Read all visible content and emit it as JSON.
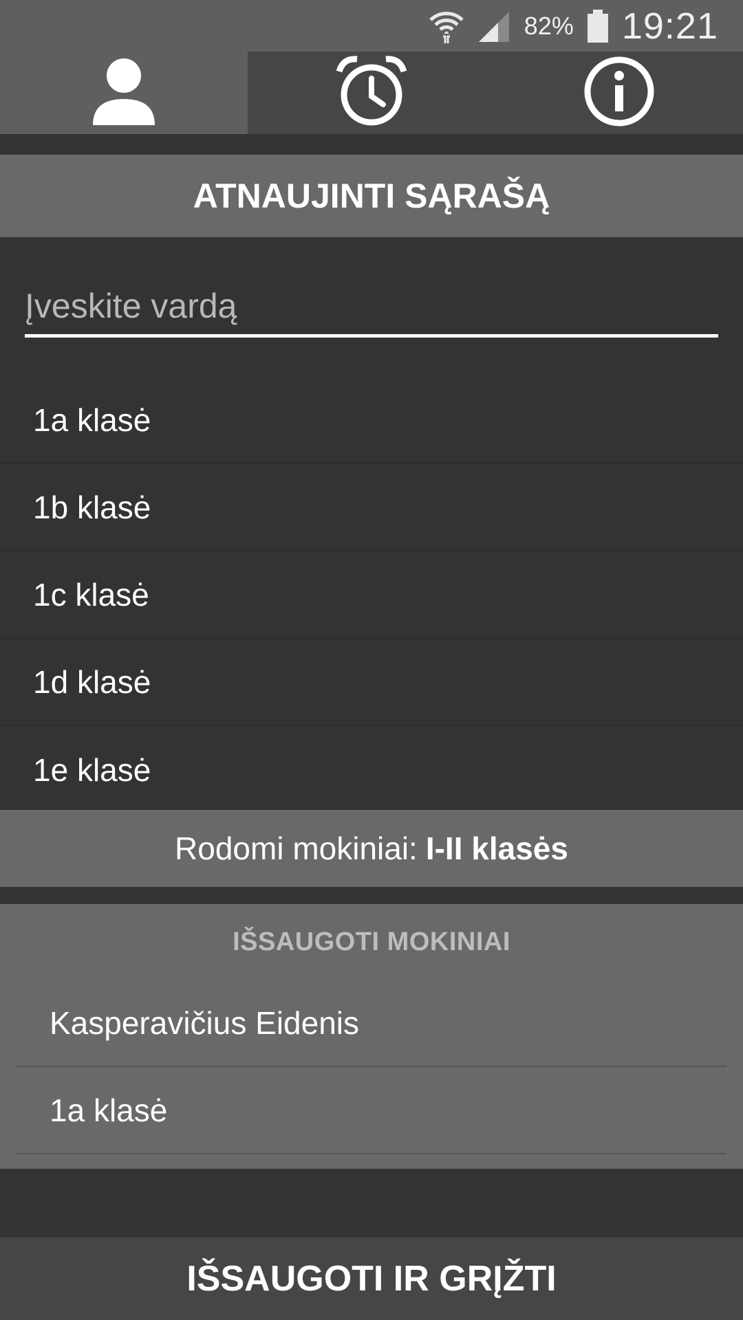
{
  "status_bar": {
    "battery_percent": "82%",
    "time": "19:21",
    "icons": [
      "wifi-icon",
      "signal-icon",
      "battery-icon"
    ]
  },
  "tabs": [
    {
      "icon": "person-icon",
      "active": true
    },
    {
      "icon": "alarm-clock-icon",
      "active": false
    },
    {
      "icon": "info-icon",
      "active": false
    }
  ],
  "refresh_button": {
    "label": "ATNAUJINTI SĄRAŠĄ"
  },
  "search": {
    "placeholder": "Įveskite vardą",
    "value": ""
  },
  "classes": [
    {
      "label": "1a klasė"
    },
    {
      "label": "1b klasė"
    },
    {
      "label": "1c klasė"
    },
    {
      "label": "1d klasė"
    },
    {
      "label": "1e klasė"
    }
  ],
  "filter": {
    "prefix": "Rodomi mokiniai:",
    "value": "I-II klasės"
  },
  "saved": {
    "title": "IŠSAUGOTI MOKINIAI",
    "items": [
      {
        "label": "Kasperavičius Eidenis"
      },
      {
        "label": "1a klasė"
      }
    ]
  },
  "save_back_button": {
    "label": "IŠSAUGOTI IR GRĮŽTI"
  },
  "colors": {
    "background": "#333333",
    "status_bar": "#5f5f5f",
    "tab_inactive": "#464646",
    "tab_active": "#5f5f5f",
    "button_gray": "#696969",
    "text": "#ffffff"
  }
}
